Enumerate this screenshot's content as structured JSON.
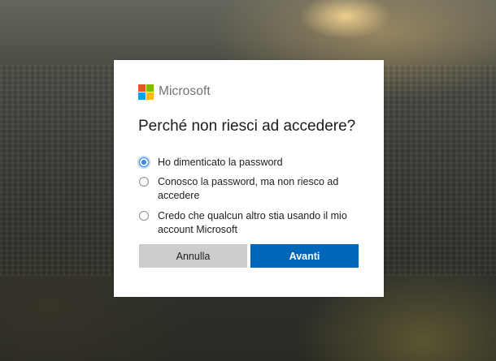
{
  "brand": {
    "name": "Microsoft",
    "logo_colors": [
      "#f25022",
      "#7fba00",
      "#00a4ef",
      "#ffb900"
    ]
  },
  "dialog": {
    "title": "Perché non riesci ad accedere?",
    "options": [
      {
        "label": "Ho dimenticato la password",
        "selected": true
      },
      {
        "label": "Conosco la password, ma non riesco ad accedere",
        "selected": false
      },
      {
        "label": "Credo che qualcun altro stia usando il mio account Microsoft",
        "selected": false
      }
    ],
    "buttons": {
      "cancel": "Annulla",
      "next": "Avanti"
    },
    "colors": {
      "primary": "#0067b8",
      "secondary": "#cccccc"
    }
  }
}
